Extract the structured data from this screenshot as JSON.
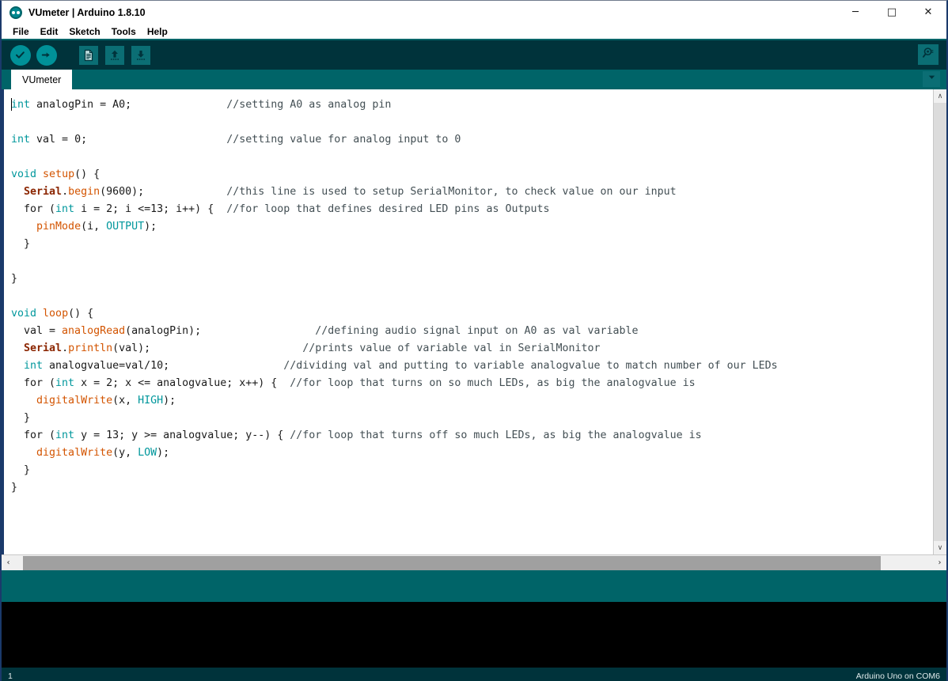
{
  "window": {
    "title": "VUmeter | Arduino 1.8.10",
    "logo_icon": "arduino-logo-icon",
    "minimize_icon": "minimize-icon",
    "maximize_icon": "maximize-icon",
    "close_icon": "close-icon",
    "minimize_glyph": "─",
    "maximize_glyph": "□",
    "close_glyph": "✕"
  },
  "menubar": {
    "items": [
      {
        "label": "File"
      },
      {
        "label": "Edit"
      },
      {
        "label": "Sketch"
      },
      {
        "label": "Tools"
      },
      {
        "label": "Help"
      }
    ]
  },
  "toolbar": {
    "verify_label": "Verify",
    "upload_label": "Upload",
    "new_label": "New",
    "open_label": "Open",
    "save_label": "Save",
    "serial_monitor_label": "Serial Monitor",
    "verify_icon": "checkmark-icon",
    "upload_icon": "arrow-right-icon",
    "new_icon": "new-document-icon",
    "open_icon": "arrow-up-icon",
    "save_icon": "arrow-down-icon",
    "serial_monitor_icon": "magnifier-icon"
  },
  "tabs": {
    "items": [
      {
        "label": "VUmeter",
        "active": true
      }
    ],
    "menu_icon": "chevron-down-icon"
  },
  "editor": {
    "scrollbar": {
      "up_glyph": "∧",
      "down_glyph": "∨",
      "left_glyph": "‹",
      "right_glyph": "›"
    },
    "code_lines": [
      [
        {
          "t": "int",
          "c": "kw"
        },
        {
          "t": " analogPin = A0;               ",
          "c": "pl"
        },
        {
          "t": "//setting A0 as analog pin",
          "c": "cmt"
        }
      ],
      [],
      [
        {
          "t": "int",
          "c": "kw"
        },
        {
          "t": " val = 0;                      ",
          "c": "pl"
        },
        {
          "t": "//setting value for analog input to 0",
          "c": "cmt"
        }
      ],
      [],
      [
        {
          "t": "void",
          "c": "kw"
        },
        {
          "t": " ",
          "c": "pl"
        },
        {
          "t": "setup",
          "c": "fn"
        },
        {
          "t": "() {",
          "c": "pl"
        }
      ],
      [
        {
          "t": "  ",
          "c": "pl"
        },
        {
          "t": "Serial",
          "c": "obj"
        },
        {
          "t": ".",
          "c": "pl"
        },
        {
          "t": "begin",
          "c": "fn"
        },
        {
          "t": "(9600);             ",
          "c": "pl"
        },
        {
          "t": "//this line is used to setup SerialMonitor, to check value on our input",
          "c": "cmt"
        }
      ],
      [
        {
          "t": "  for (",
          "c": "pl"
        },
        {
          "t": "int",
          "c": "kw"
        },
        {
          "t": " i = 2; i <=13; i++) {  ",
          "c": "pl"
        },
        {
          "t": "//for loop that defines desired LED pins as Outputs",
          "c": "cmt"
        }
      ],
      [
        {
          "t": "    ",
          "c": "pl"
        },
        {
          "t": "pinMode",
          "c": "fn"
        },
        {
          "t": "(i, ",
          "c": "pl"
        },
        {
          "t": "OUTPUT",
          "c": "kw"
        },
        {
          "t": ");",
          "c": "pl"
        }
      ],
      [
        {
          "t": "  }",
          "c": "pl"
        }
      ],
      [],
      [
        {
          "t": "}",
          "c": "pl"
        }
      ],
      [],
      [
        {
          "t": "void",
          "c": "kw"
        },
        {
          "t": " ",
          "c": "pl"
        },
        {
          "t": "loop",
          "c": "fn"
        },
        {
          "t": "() {",
          "c": "pl"
        }
      ],
      [
        {
          "t": "  val = ",
          "c": "pl"
        },
        {
          "t": "analogRead",
          "c": "fn"
        },
        {
          "t": "(analogPin);                  ",
          "c": "pl"
        },
        {
          "t": "//defining audio signal input on A0 as val variable",
          "c": "cmt"
        }
      ],
      [
        {
          "t": "  ",
          "c": "pl"
        },
        {
          "t": "Serial",
          "c": "obj"
        },
        {
          "t": ".",
          "c": "pl"
        },
        {
          "t": "println",
          "c": "fn"
        },
        {
          "t": "(val);                        ",
          "c": "pl"
        },
        {
          "t": "//prints value of variable val in SerialMonitor",
          "c": "cmt"
        }
      ],
      [
        {
          "t": "  ",
          "c": "pl"
        },
        {
          "t": "int",
          "c": "kw"
        },
        {
          "t": " analogvalue=val/10;                  ",
          "c": "pl"
        },
        {
          "t": "//dividing val and putting to variable analogvalue to match number of our LEDs",
          "c": "cmt"
        }
      ],
      [
        {
          "t": "  for (",
          "c": "pl"
        },
        {
          "t": "int",
          "c": "kw"
        },
        {
          "t": " x = 2; x <= analogvalue; x++) {  ",
          "c": "pl"
        },
        {
          "t": "//for loop that turns on so much LEDs, as big the analogvalue is",
          "c": "cmt"
        }
      ],
      [
        {
          "t": "    ",
          "c": "pl"
        },
        {
          "t": "digitalWrite",
          "c": "fn"
        },
        {
          "t": "(x, ",
          "c": "pl"
        },
        {
          "t": "HIGH",
          "c": "kw"
        },
        {
          "t": ");",
          "c": "pl"
        }
      ],
      [
        {
          "t": "  }",
          "c": "pl"
        }
      ],
      [
        {
          "t": "  for (",
          "c": "pl"
        },
        {
          "t": "int",
          "c": "kw"
        },
        {
          "t": " y = 13; y >= analogvalue; y--) { ",
          "c": "pl"
        },
        {
          "t": "//for loop that turns off so much LEDs, as big the analogvalue is",
          "c": "cmt"
        }
      ],
      [
        {
          "t": "    ",
          "c": "pl"
        },
        {
          "t": "digitalWrite",
          "c": "fn"
        },
        {
          "t": "(y, ",
          "c": "pl"
        },
        {
          "t": "LOW",
          "c": "kw"
        },
        {
          "t": ");",
          "c": "pl"
        }
      ],
      [
        {
          "t": "  }",
          "c": "pl"
        }
      ],
      [
        {
          "t": "}",
          "c": "pl"
        }
      ]
    ]
  },
  "console": {
    "text": ""
  },
  "statusbar": {
    "line_number": "1",
    "board_info": "Arduino Uno on COM6"
  },
  "colors": {
    "toolbar_bg": "#00333b",
    "tabbar_bg": "#006468",
    "keyword": "#00979c",
    "function": "#d35400",
    "object": "#8b2500",
    "comment": "#434f54",
    "console_bg": "#000000"
  }
}
